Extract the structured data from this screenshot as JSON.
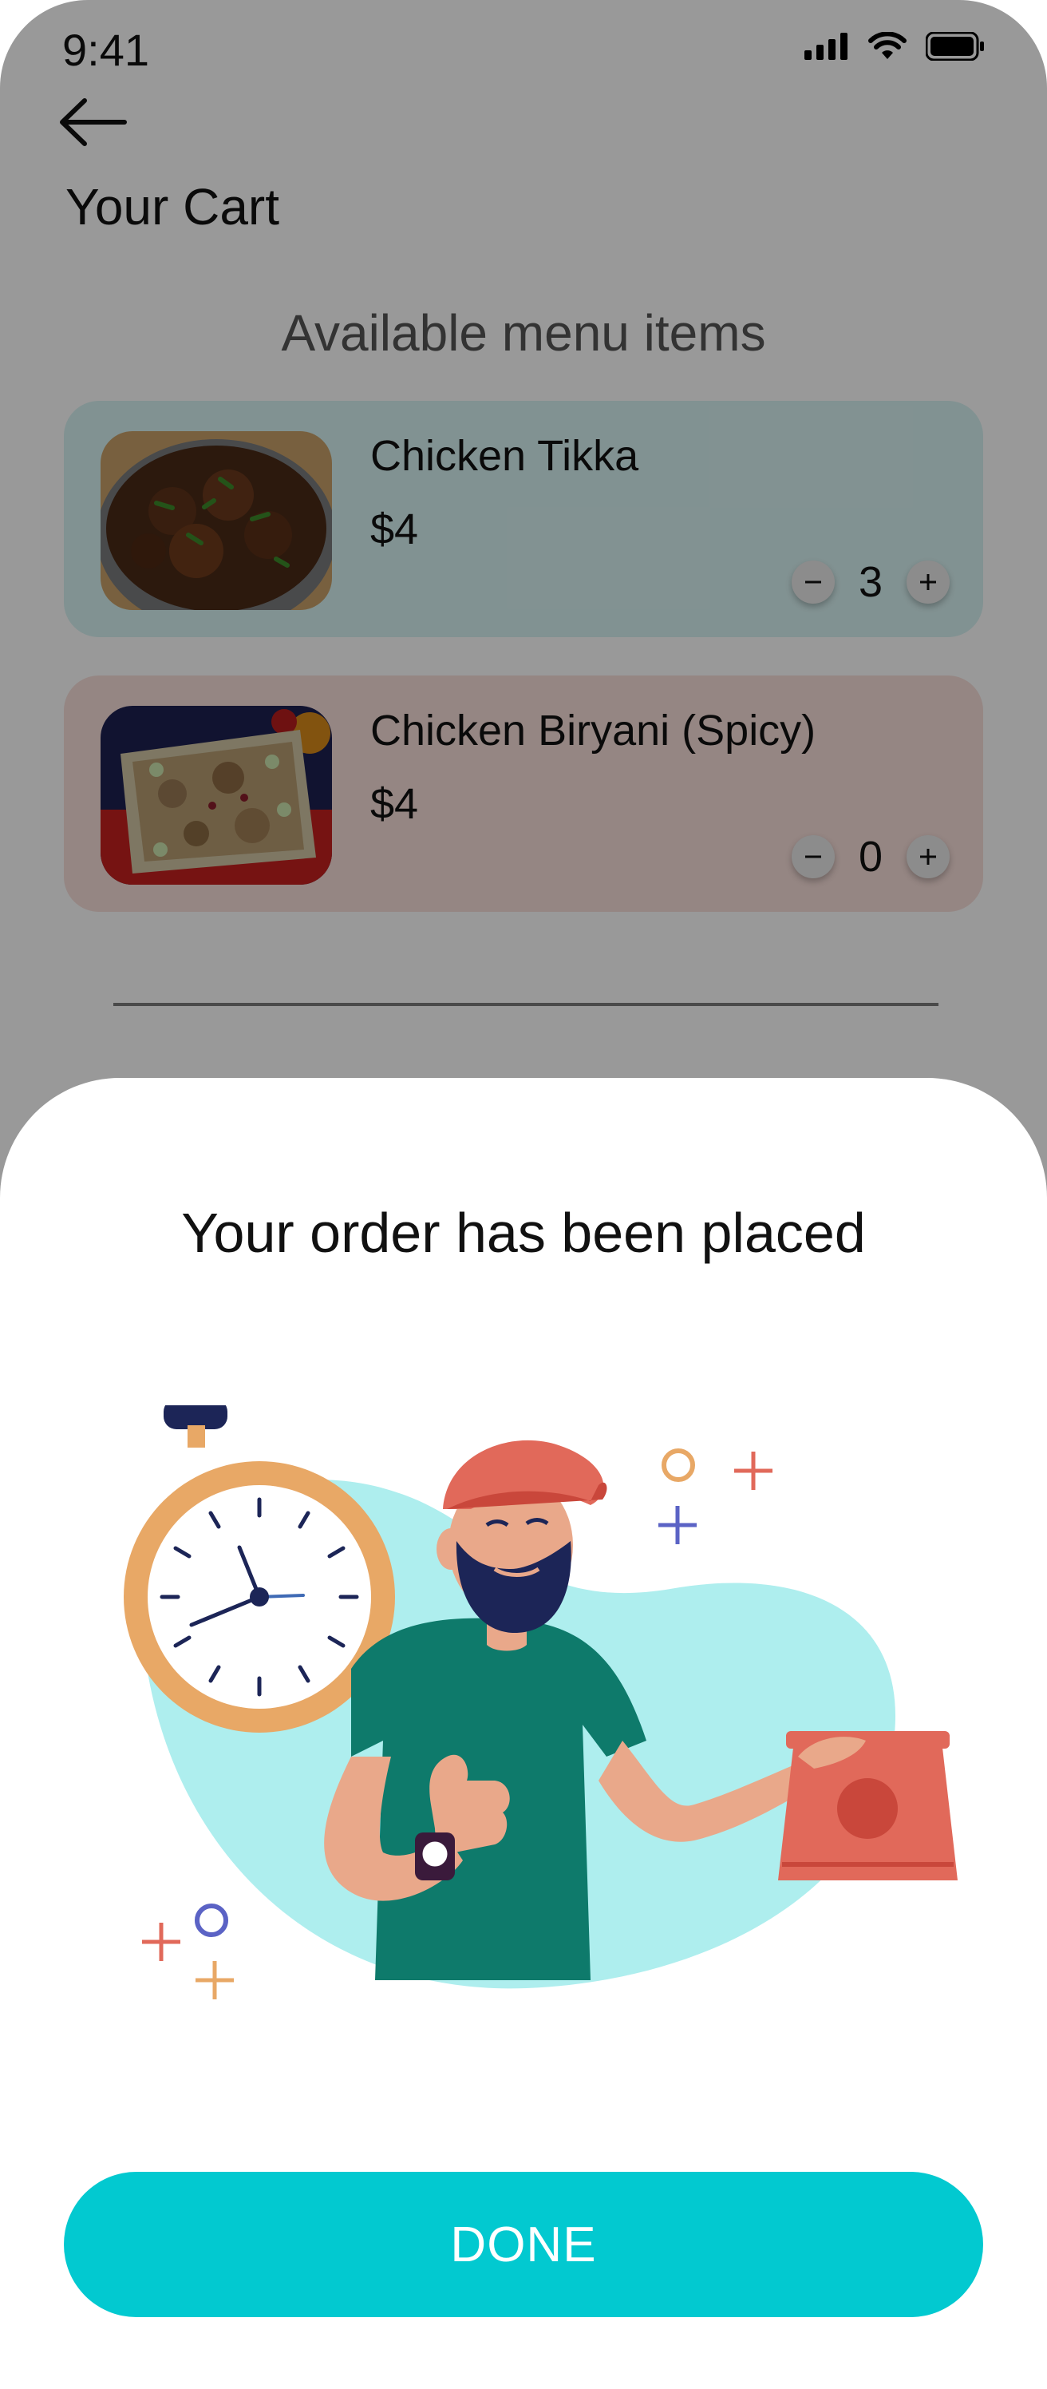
{
  "status_bar": {
    "time": "9:41"
  },
  "header": {
    "title": "Your Cart"
  },
  "menu": {
    "section_title": "Available menu items",
    "items": [
      {
        "name": "Chicken Tikka",
        "price": "$4",
        "quantity": "3",
        "card_color": "#d8f3f3"
      },
      {
        "name": "Chicken Biryani (Spicy)",
        "price": "$4",
        "quantity": "0",
        "card_color": "#f8dfda"
      }
    ]
  },
  "dialog": {
    "title": "Your order has been placed",
    "button_label": "DONE",
    "accent_color": "#02c9d0"
  },
  "icons": [
    "back-arrow-icon",
    "signal-icon",
    "wifi-icon",
    "battery-icon",
    "minus-icon",
    "plus-icon"
  ]
}
